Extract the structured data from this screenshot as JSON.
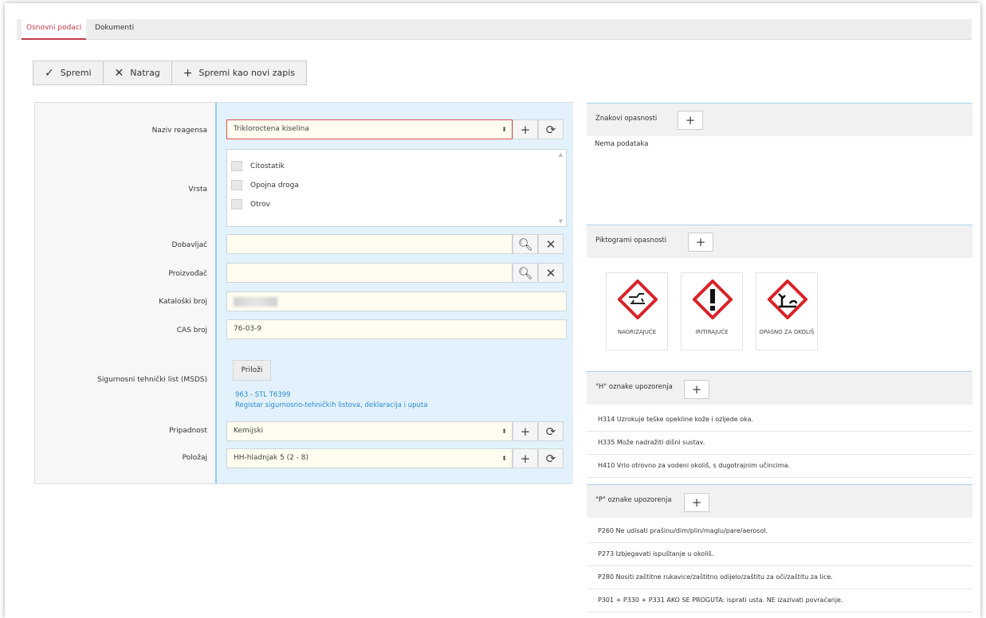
{
  "tabs": [
    {
      "label": "Osnovni podaci",
      "active": true
    },
    {
      "label": "Dokumenti",
      "active": false
    }
  ],
  "toolbar": {
    "save": "Spremi",
    "back": "Natrag",
    "save_new": "Spremi kao novi zapis"
  },
  "form": {
    "naziv_label": "Naziv reagensa",
    "naziv_value": "Trikloroctena kiselina",
    "vrsta_label": "Vrsta",
    "vrsta_options": [
      "Citostatik",
      "Opojna droga",
      "Otrov"
    ],
    "dobavljac_label": "Dobavljač",
    "dobavljac_value": "",
    "proizvodac_label": "Proizvođač",
    "proizvodac_value": "",
    "katalog_label": "Kataloški broj",
    "cas_label": "CAS broj",
    "cas_value": "76-03-9",
    "msds_label": "Sigurnosni tehnički list (MSDS)",
    "attach": "Priloži",
    "msds_link1": "963 - STL T6399",
    "msds_link2": "Registar sigurnosno-tehničkih listova, deklaracija i uputa",
    "pripadnost_label": "Pripadnost",
    "pripadnost_value": "Kemijski",
    "polozaj_label": "Položaj",
    "polozaj_value": "HH-hladnjak 5 (2 - 8)"
  },
  "right": {
    "znakovi_title": "Znakovi opasnosti",
    "no_data": "Nema podataka",
    "piktogrami_title": "Piktogrami opasnosti",
    "pictograms": [
      "NAGRIZAJUĆE",
      "IRITIRAJUĆE",
      "OPASNO ZA OKOLIŠ"
    ],
    "h_title": "\"H\" oznake upozorenja",
    "h_rows": [
      "H314  Uzrokuje teške opekline kože i ozljede oka.",
      "H335  Može nadražiti dišni sustav.",
      "H410  Vrlo otrovno za vodeni okoliš, s dugotrajnim učincima."
    ],
    "p_title": "\"P\" oznake upozorenja",
    "p_rows": [
      "P260  Ne udisati prašinu/dim/plin/maglu/pare/aerosol.",
      "P273  Izbjegavati ispuštanje u okoliš.",
      "P280  Nositi zaštitne rukavice/zaštitno odijelo/zaštitu za oči/zaštitu za lice.",
      "P301 + P330 + P331   AKO SE PROGUTA: isprati usta. NE izazivati povraćanje."
    ]
  }
}
